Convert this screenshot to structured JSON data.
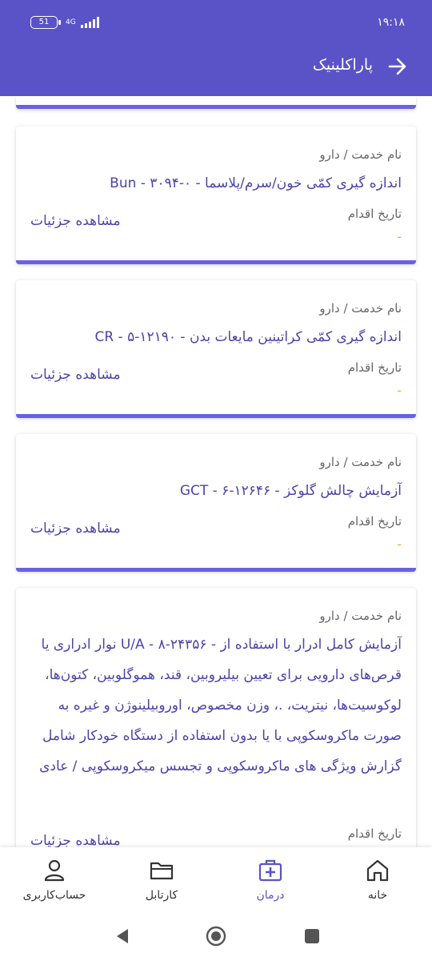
{
  "status_bar": {
    "time": "۱۹:۱۸",
    "battery": "51",
    "network": "4G"
  },
  "header": {
    "title": "پاراکلینیک"
  },
  "cards": [
    {
      "label": "نام خدمت / دارو",
      "title": "اندازه گیری کمّی  خون/سرم/پلاسما  - Bun - ۳۰۹۴-۰",
      "date_label": "تاریخ اقدام",
      "date_value": "-",
      "details": "مشاهده جزئیات"
    },
    {
      "label": "نام خدمت / دارو",
      "title": "اندازه گیری کمّی کراتینین مایعات بدن - CR  - ۵-۱۲۱۹۰",
      "date_label": "تاریخ اقدام",
      "date_value": "-",
      "details": "مشاهده جزئیات"
    },
    {
      "label": "نام خدمت / دارو",
      "title": "آزمایش چالش گلوکز  - GCT - ۶-۱۲۶۴۶",
      "date_label": "تاریخ اقدام",
      "date_value": "-",
      "details": "مشاهده جزئیات"
    },
    {
      "label": "نام خدمت / دارو",
      "title": "آزمایش کامل ادرار با استفاده از - U/A   - ۸-۲۴۳۵۶ نوار ادراری یا قرص‌های دارویی برای تعیین بیلیروبین، قند، هموگلوبین، کتون‌ها، لوکوسیت‌ها، نیتریت، .، وزن مخصوص، اوروبیلینوژن و غیره به صورت ماکروسکوپی با یا بدون استفاده از دستگاه خودکار شامل گزارش ویژگی های ماکروسکوپی و تجسس میکروسکوپی / عادی",
      "date_label": "تاریخ اقدام",
      "date_value": "-",
      "details": "مشاهده جزئیات"
    }
  ],
  "bottom_nav": {
    "home": "خانه",
    "treatment": "درمان",
    "cardtable": "کارتابل",
    "account": "حساب‌کاربری"
  },
  "colors": {
    "primary": "#5a52c7",
    "accent_line": "#6a61e0",
    "date_dash": "#f5a623",
    "text_link": "#4b44a8"
  },
  "icons": {
    "back": "arrow-right-icon",
    "home": "home-icon",
    "treatment": "medical-case-icon",
    "cardtable": "folder-icon",
    "account": "user-icon"
  }
}
